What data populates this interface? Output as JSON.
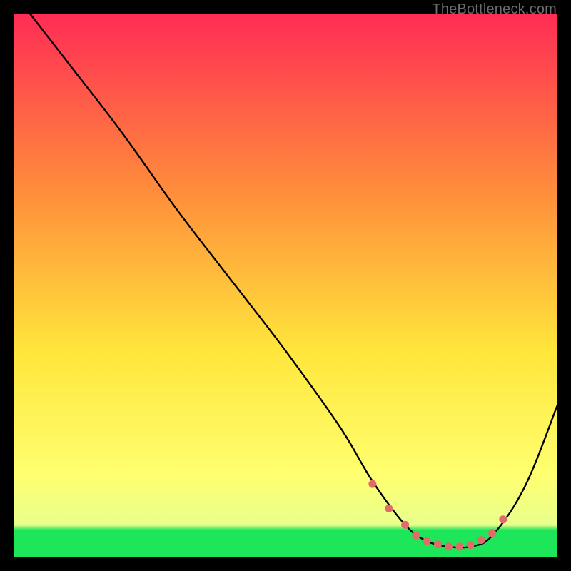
{
  "watermark": "TheBottleneck.com",
  "chart_data": {
    "type": "line",
    "title": "",
    "xlabel": "",
    "ylabel": "",
    "xlim": [
      0,
      100
    ],
    "ylim": [
      0,
      100
    ],
    "background_gradient": {
      "top": "#FF2C55",
      "mid_upper": "#FF8E3B",
      "mid": "#FFE63B",
      "mid_lower": "#FFFF70",
      "bottom_band": "#1EE65A"
    },
    "series": [
      {
        "name": "bottleneck-curve",
        "color": "#000000",
        "x": [
          3,
          10,
          20,
          30,
          40,
          50,
          60,
          66,
          72,
          76,
          80,
          84,
          88,
          94,
          100
        ],
        "values": [
          100,
          91,
          78,
          64,
          51,
          38,
          24,
          14,
          6,
          3,
          2,
          2,
          4,
          13,
          28
        ]
      }
    ],
    "markers": {
      "name": "valley-dots",
      "color": "#E16A6A",
      "points": [
        {
          "x": 66,
          "y": 13.5
        },
        {
          "x": 69,
          "y": 9
        },
        {
          "x": 72,
          "y": 6
        },
        {
          "x": 74,
          "y": 4
        },
        {
          "x": 76,
          "y": 3
        },
        {
          "x": 78,
          "y": 2.4
        },
        {
          "x": 80,
          "y": 2
        },
        {
          "x": 82,
          "y": 2
        },
        {
          "x": 84,
          "y": 2.3
        },
        {
          "x": 86,
          "y": 3.2
        },
        {
          "x": 88,
          "y": 4.5
        },
        {
          "x": 90,
          "y": 7
        }
      ]
    }
  }
}
